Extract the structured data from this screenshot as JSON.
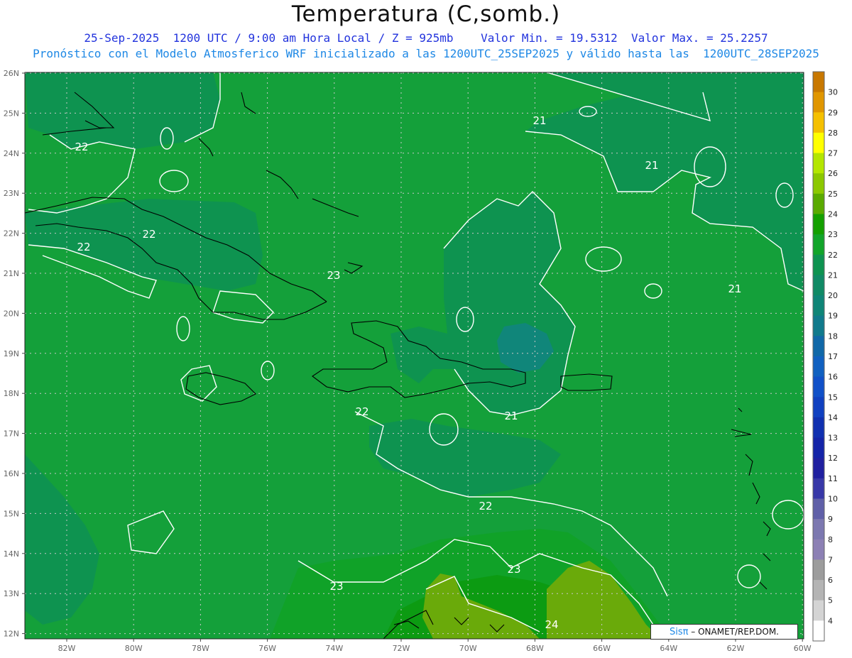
{
  "title": "Temperatura (C,somb.)",
  "subtitle_line1": "25-Sep-2025  1200 UTC / 9:00 am Hora Local / Z = 925mb    Valor Min. = 19.5312  Valor Max. = 25.2257",
  "subtitle_line2": "Pronóstico con el Modelo Atmosferico WRF inicializado a las 1200UTC_25SEP2025 y válido hasta las  1200UTC_28SEP2025",
  "map": {
    "lon_ticks": [
      "82W",
      "80W",
      "78W",
      "76W",
      "74W",
      "72W",
      "70W",
      "68W",
      "66W",
      "64W",
      "62W",
      "60W"
    ],
    "lat_ticks": [
      "26N",
      "25N",
      "24N",
      "23N",
      "22N",
      "21N",
      "20N",
      "19N",
      "18N",
      "17N",
      "16N",
      "15N",
      "14N",
      "13N",
      "12N"
    ],
    "contour_labels": [
      "22",
      "22",
      "22",
      "21",
      "21",
      "21",
      "23",
      "22",
      "21",
      "22",
      "23",
      "23",
      "24"
    ],
    "colors": {
      "t20_21": "#0e9350",
      "t21_22": "#14a03a",
      "t22_23": "#12a52a",
      "t23_24": "#0d9e14",
      "t24_25": "#6aaa0a",
      "t19_20": "#10867a",
      "contour": "#ffffff",
      "coast": "#000000",
      "grid": "#c8c8c8"
    }
  },
  "colorbar": {
    "labels": [
      "30",
      "29",
      "28",
      "27",
      "26",
      "25",
      "24",
      "23",
      "22",
      "21",
      "20",
      "19",
      "18",
      "17",
      "16",
      "15",
      "14",
      "13",
      "12",
      "11",
      "10",
      "9",
      "8",
      "7",
      "6",
      "5",
      "4"
    ],
    "colors": [
      "#c87800",
      "#e09600",
      "#f5c000",
      "#ffff00",
      "#b4e600",
      "#8cc800",
      "#5aaa00",
      "#14a000",
      "#12a52a",
      "#0e9350",
      "#108a65",
      "#0f8577",
      "#107a8c",
      "#1068a8",
      "#1060c0",
      "#1050c8",
      "#1040c0",
      "#1030b0",
      "#1424a8",
      "#2020a0",
      "#3838a8",
      "#6060a8",
      "#7c78b0",
      "#8c80b4",
      "#9c9c9c",
      "#b4b4b4",
      "#d4d4d4",
      "#ffffff"
    ]
  },
  "brand": {
    "logo": "Sisπ",
    "text": "– ONAMET/REP.DOM."
  }
}
